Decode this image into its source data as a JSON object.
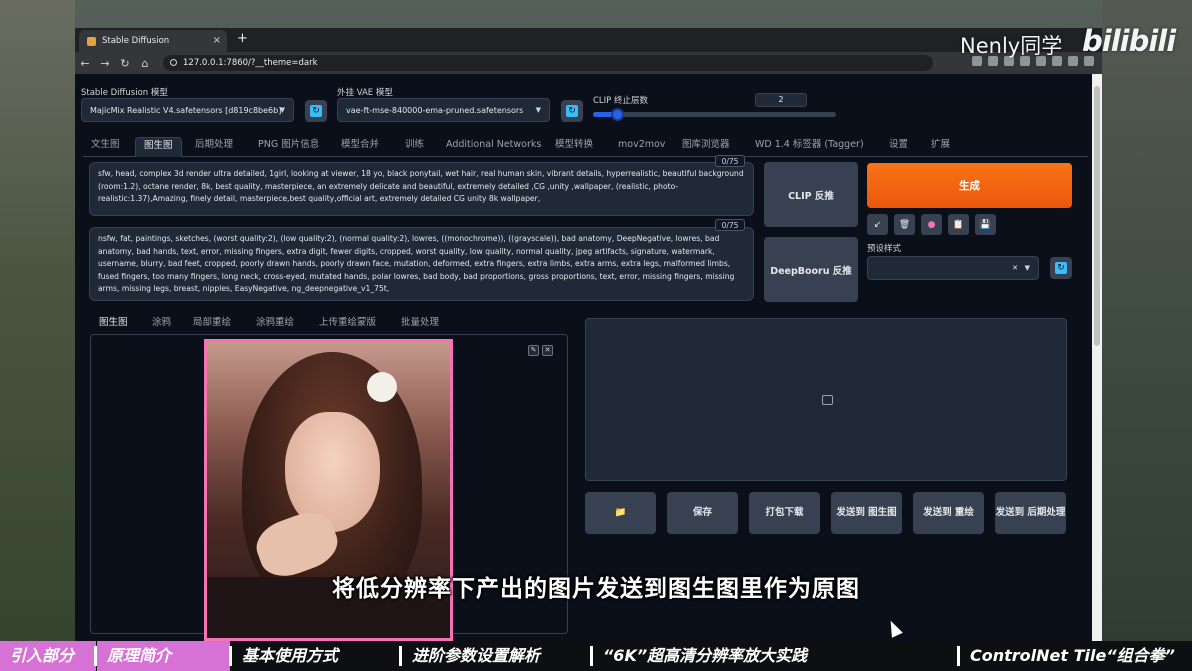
{
  "browser": {
    "tab_title": "Stable Diffusion",
    "tab_close": "×",
    "new_tab": "+",
    "url": "127.0.0.1:7860/?__theme=dark"
  },
  "settings": {
    "sd_model_label": "Stable Diffusion 模型",
    "sd_model_value": "MajicMix Realistic V4.safetensors [d819c8be6b]",
    "vae_label": "外挂 VAE 模型",
    "vae_value": "vae-ft-mse-840000-ema-pruned.safetensors",
    "clip_label": "CLIP 终止层数",
    "clip_value": "2",
    "clip_level": 0.1
  },
  "tabs": [
    "文生图",
    "图生图",
    "后期处理",
    "PNG 图片信息",
    "模型合并",
    "训练",
    "Additional Networks",
    "模型转换",
    "mov2mov",
    "图库浏览器",
    "WD 1.4 标签器 (Tagger)",
    "设置",
    "扩展"
  ],
  "prompt": {
    "positive": "sfw, head,  complex 3d render ultra detailed, 1girl, looking at viewer, 18 yo, black ponytail, wet hair, real human skin, vibrant details, hyperrealistic, beautiful background (room:1.2), octane render, 8k, best quality, masterpiece, an extremely delicate and beautiful, extremely detailed ,CG ,unity ,wallpaper, (realistic, photo-realistic:1.37),Amazing, finely detail, masterpiece,best quality,official art, extremely detailed CG unity 8k wallpaper,",
    "positive_counter": "0/75",
    "negative": "nsfw, fat, paintings, sketches, (worst quality:2), (low quality:2), (normal quality:2), lowres, ((monochrome)), ((grayscale)), bad anatomy, DeepNegative, lowres, bad anatomy, bad hands, text, error, missing fingers, extra digit, fewer digits, cropped, worst quality, low quality, normal quality, jpeg artifacts, signature, watermark, username, blurry, bad feet, cropped, poorly drawn hands, poorly drawn face, mutation, deformed, extra fingers, extra limbs, extra arms, extra legs, malformed limbs, fused fingers, too many fingers, long neck, cross-eyed, mutated hands, polar lowres, bad body, bad proportions, gross proportions, text, error, missing fingers, missing arms, missing legs, breast, nipples, EasyNegative, ng_deepnegative_v1_75t,",
    "negative_counter": "0/75"
  },
  "buttons": {
    "clip_interrogate": "CLIP 反推",
    "deepbooru": "DeepBooru 反推",
    "generate": "生成",
    "styles_label": "预设样式",
    "styles_clear": "✕"
  },
  "subtabs": [
    "图生图",
    "涂鸦",
    "局部重绘",
    "涂鸦重绘",
    "上传重绘蒙版",
    "批量处理"
  ],
  "actions": [
    "📁",
    "保存",
    "打包下载",
    "发送到 图生图",
    "发送到 重绘",
    "发送到 后期处理"
  ],
  "overlay": {
    "subtitle": "将低分辨率下产出的图片发送到图生图里作为原图",
    "watermark": "Nenly同学",
    "logo": "bilibili"
  },
  "chapters": [
    "引入部分",
    "原理简介",
    "基本使用方式",
    "进阶参数设置解析",
    "“6K”超高清分辨率放大实践",
    "ControlNet Tile“组合拳”"
  ],
  "chapters_done": 2,
  "colors": {
    "accent": "#ea580c",
    "chapter_done": "#d671d6",
    "image_border": "#f472b6"
  }
}
